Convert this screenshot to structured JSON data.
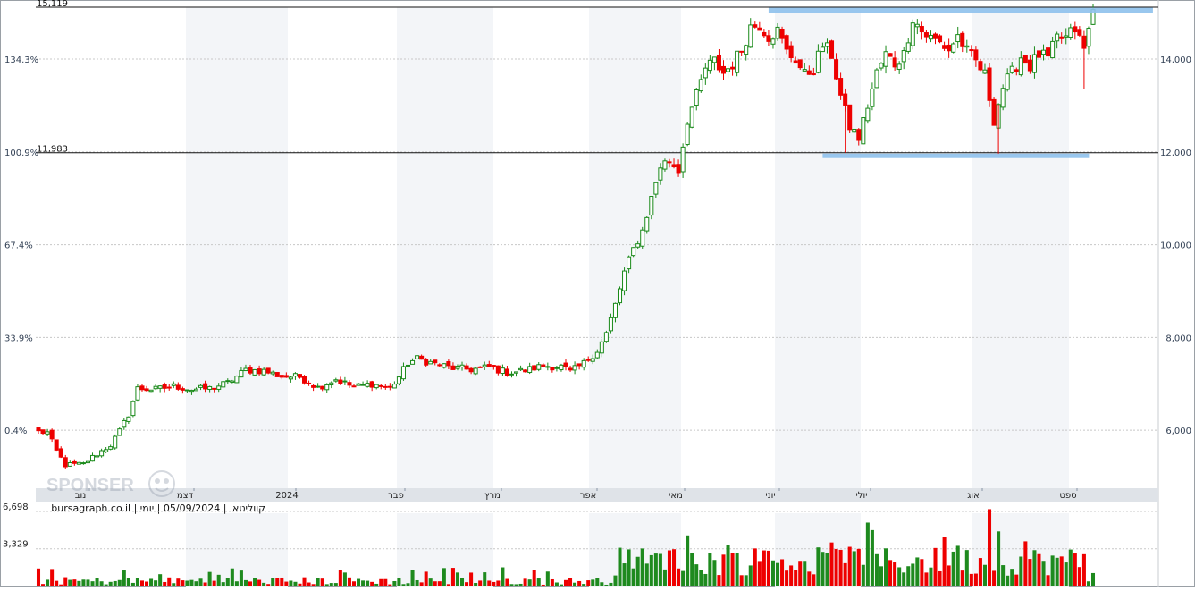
{
  "header": {
    "caption": "bursagraph.co.il | קווליטאו | 05/09/2024 | יומי"
  },
  "watermark": {
    "text": "SPONSER"
  },
  "colors": {
    "up": "#1a8a1a",
    "down": "#ee0000",
    "band": "#8ec1ec",
    "grid": "#c8c8c8",
    "axis_text": "#334155"
  },
  "chart_data": [
    {
      "type": "candlestick",
      "title": "",
      "x_tick_labels": [
        "נוב",
        "דצמ",
        "2024",
        "פבר",
        "מרץ",
        "אפר",
        "מאי",
        "יוני",
        "יולי",
        "אוג",
        "ספט"
      ],
      "y_right_ticks": [
        {
          "value": 6000,
          "label": "6,000"
        },
        {
          "value": 8000,
          "label": "8,000"
        },
        {
          "value": 10000,
          "label": "10,000"
        },
        {
          "value": 12000,
          "label": "12,000"
        },
        {
          "value": 14000,
          "label": "14,000"
        }
      ],
      "y_left_pct_ticks": [
        {
          "value": 6000,
          "label": "0.4%"
        },
        {
          "value": 8000,
          "label": "33.9%"
        },
        {
          "value": 10000,
          "label": "67.4%"
        },
        {
          "value": 12000,
          "label": "100.9%"
        },
        {
          "value": 14000,
          "label": "134.3%"
        }
      ],
      "ylim": [
        4750,
        15119
      ],
      "horizontal_levels": [
        {
          "value": 15119,
          "label": "15,119"
        },
        {
          "value": 11983,
          "label": "11,983"
        }
      ],
      "resistance_band": {
        "value": 15050,
        "from_session": 162,
        "to_session": 212
      },
      "support_band": {
        "value": 11925,
        "from_session": 173,
        "to_session": 231
      },
      "keyframes": [
        [
          0,
          5970
        ],
        [
          2,
          5950
        ],
        [
          4,
          5550
        ],
        [
          6,
          5250
        ],
        [
          10,
          5270
        ],
        [
          12,
          5420
        ],
        [
          14,
          5550
        ],
        [
          16,
          5680
        ],
        [
          18,
          5980
        ],
        [
          20,
          6340
        ],
        [
          22,
          6900
        ],
        [
          26,
          6880
        ],
        [
          30,
          6950
        ],
        [
          34,
          6880
        ],
        [
          38,
          6900
        ],
        [
          42,
          7020
        ],
        [
          46,
          7300
        ],
        [
          50,
          7280
        ],
        [
          54,
          7160
        ],
        [
          58,
          7150
        ],
        [
          62,
          6920
        ],
        [
          66,
          7100
        ],
        [
          70,
          6930
        ],
        [
          74,
          7000
        ],
        [
          78,
          6900
        ],
        [
          80,
          7150
        ],
        [
          82,
          7450
        ],
        [
          84,
          7540
        ],
        [
          88,
          7430
        ],
        [
          92,
          7340
        ],
        [
          96,
          7310
        ],
        [
          100,
          7360
        ],
        [
          104,
          7240
        ],
        [
          108,
          7290
        ],
        [
          112,
          7390
        ],
        [
          116,
          7370
        ],
        [
          118,
          7250
        ],
        [
          121,
          7440
        ],
        [
          124,
          7720
        ],
        [
          126,
          8080
        ],
        [
          128,
          8700
        ],
        [
          130,
          9400
        ],
        [
          132,
          9900
        ],
        [
          134,
          10300
        ],
        [
          136,
          11000
        ],
        [
          138,
          11700
        ],
        [
          140,
          11820
        ],
        [
          142,
          11600
        ],
        [
          144,
          12700
        ],
        [
          146,
          13200
        ],
        [
          148,
          13800
        ],
        [
          150,
          13950
        ],
        [
          152,
          13700
        ],
        [
          154,
          13900
        ],
        [
          156,
          14200
        ],
        [
          158,
          14700
        ],
        [
          160,
          14750
        ],
        [
          162,
          14500
        ],
        [
          164,
          14600
        ],
        [
          166,
          14150
        ],
        [
          168,
          14000
        ],
        [
          170,
          13650
        ],
        [
          172,
          13800
        ],
        [
          174,
          14300
        ],
        [
          176,
          14100
        ],
        [
          178,
          13200
        ],
        [
          180,
          12550
        ],
        [
          182,
          12300
        ],
        [
          184,
          13000
        ],
        [
          186,
          13700
        ],
        [
          188,
          14100
        ],
        [
          190,
          13900
        ],
        [
          192,
          14100
        ],
        [
          194,
          14900
        ],
        [
          196,
          14600
        ],
        [
          198,
          14450
        ],
        [
          200,
          14350
        ],
        [
          202,
          14200
        ],
        [
          204,
          14500
        ],
        [
          206,
          14150
        ],
        [
          208,
          13950
        ],
        [
          210,
          13650
        ],
        [
          212,
          12700
        ],
        [
          214,
          13400
        ],
        [
          216,
          13700
        ],
        [
          218,
          14050
        ],
        [
          220,
          13850
        ],
        [
          222,
          14100
        ],
        [
          224,
          14000
        ],
        [
          226,
          14450
        ],
        [
          228,
          14450
        ],
        [
          230,
          14650
        ],
        [
          232,
          14200
        ],
        [
          234,
          15050
        ]
      ],
      "volume_ticks": [
        {
          "value": 6698,
          "label": "6,698"
        },
        {
          "value": 3329,
          "label": "3,329"
        }
      ]
    }
  ]
}
